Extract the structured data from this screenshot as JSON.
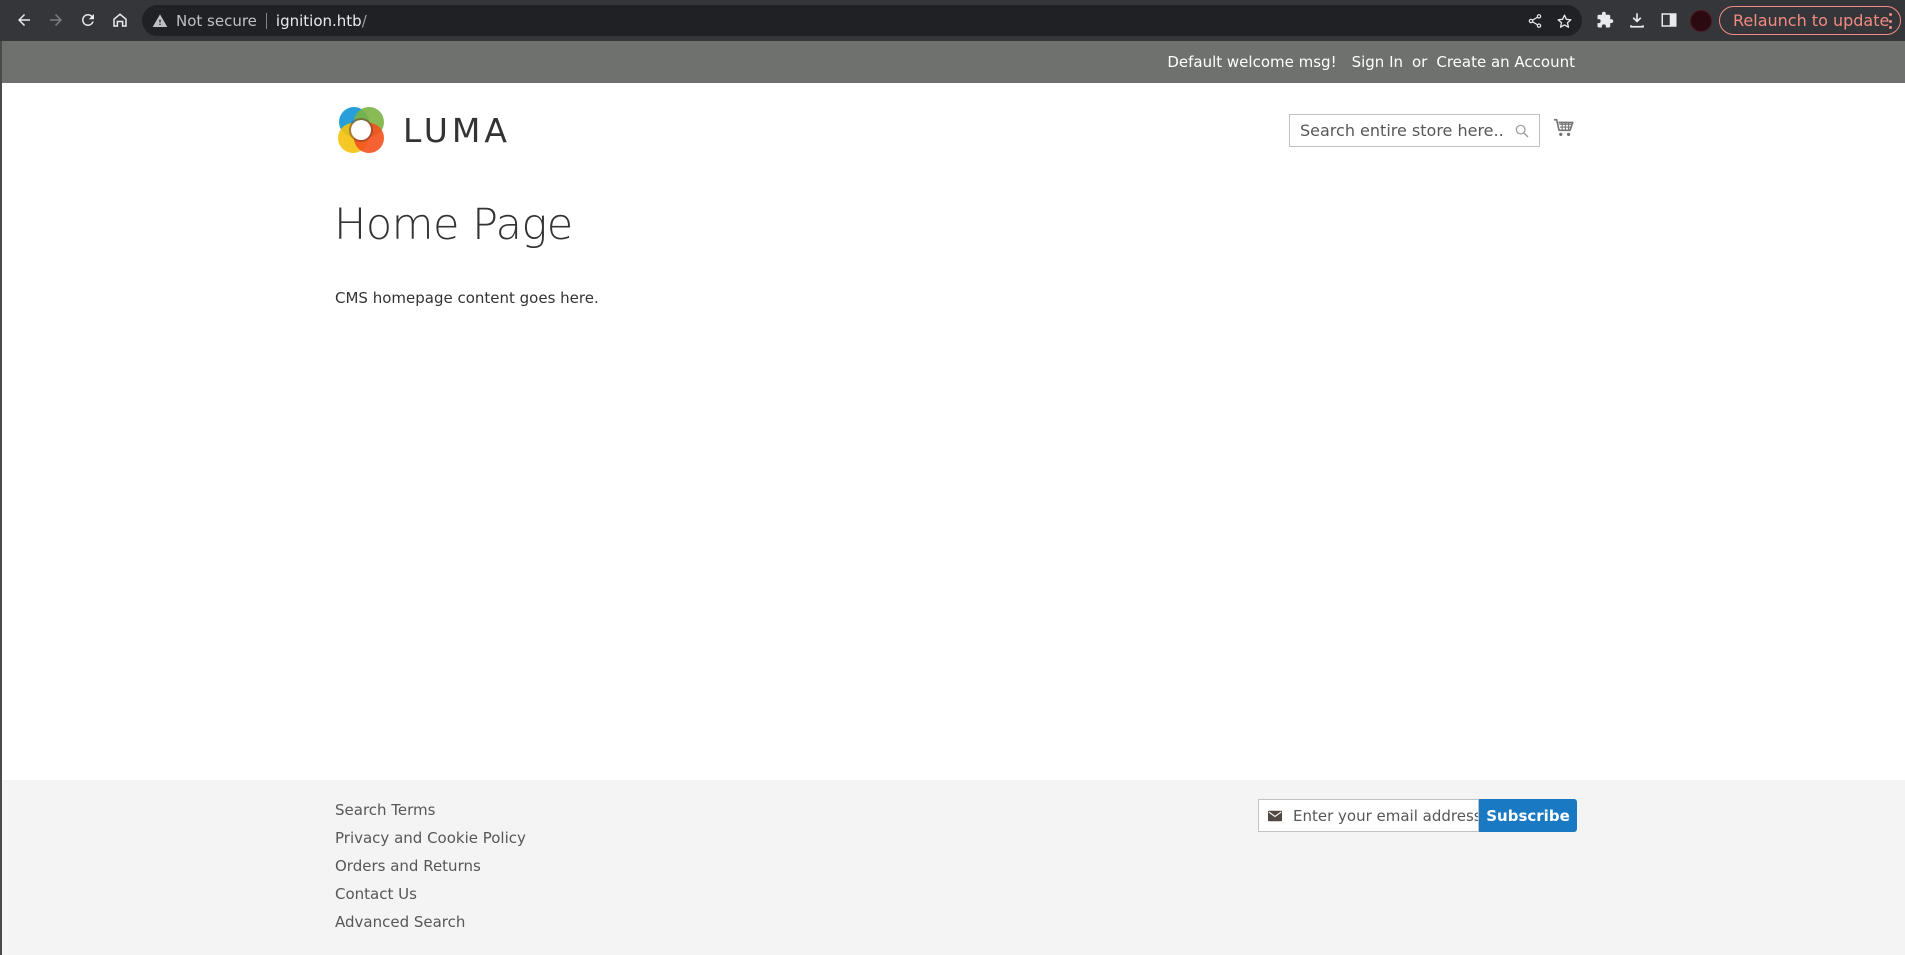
{
  "browser": {
    "security_label": "Not secure",
    "url_host": "ignition.htb",
    "url_path": "/",
    "relaunch_label": "Relaunch to update",
    "colors": {
      "chrome_bg": "#35363a",
      "omnibox_bg": "#202124",
      "relaunch": "#f28b82"
    }
  },
  "panel_header": {
    "welcome": "Default welcome msg!",
    "sign_in": "Sign In",
    "or": "or",
    "create_account": "Create an Account",
    "bg_color": "#6e716e"
  },
  "header": {
    "logo_text": "LUMA",
    "search_placeholder": "Search entire store here..."
  },
  "main": {
    "title": "Home Page",
    "content": "CMS homepage content goes here."
  },
  "footer": {
    "links": [
      {
        "label": "Search Terms"
      },
      {
        "label": "Privacy and Cookie Policy"
      },
      {
        "label": "Orders and Returns"
      },
      {
        "label": "Contact Us"
      },
      {
        "label": "Advanced Search"
      }
    ],
    "newsletter_placeholder": "Enter your email address",
    "subscribe_label": "Subscribe",
    "accent_color": "#1979c3"
  }
}
